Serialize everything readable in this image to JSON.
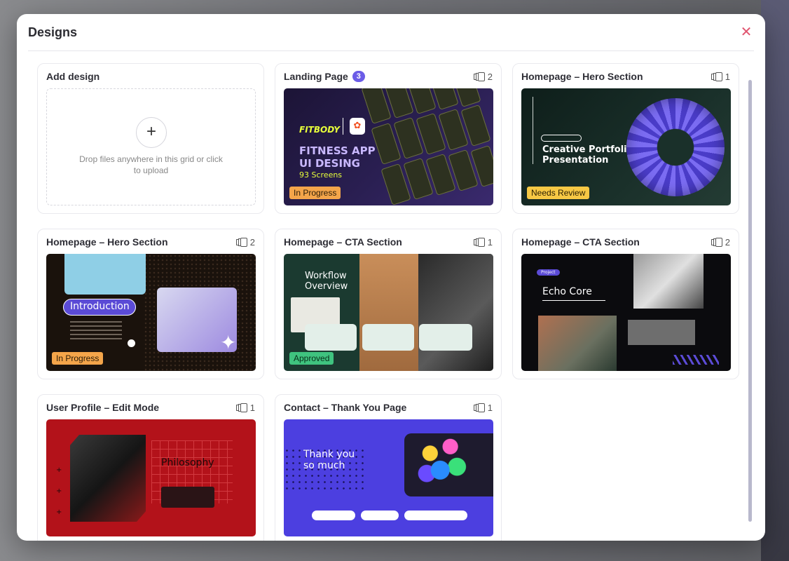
{
  "modal": {
    "title": "Designs",
    "close_icon": "close-icon"
  },
  "add_card": {
    "title": "Add design",
    "drop_text": "Drop files anywhere in this grid or click to upload"
  },
  "cards": [
    {
      "title": "Landing Page",
      "badge": "3",
      "pages": "2",
      "status": "In Progress",
      "thumb": {
        "brand": "FITBODY",
        "headline1": "FITNESS APP",
        "headline2": "UI DESING",
        "sub": "93 Screens"
      }
    },
    {
      "title": "Homepage – Hero Section",
      "pages": "1",
      "status": "Needs Review",
      "thumb": {
        "headline1": "Creative Portfolio",
        "headline2": "Presentation"
      }
    },
    {
      "title": "Homepage – Hero Section",
      "pages": "2",
      "status": "In Progress",
      "thumb": {
        "headline": "Introduction"
      }
    },
    {
      "title": "Homepage – CTA Section",
      "pages": "1",
      "status": "Approved",
      "thumb": {
        "headline1": "Workflow",
        "headline2": "Overview"
      }
    },
    {
      "title": "Homepage – CTA Section",
      "pages": "2",
      "status": "",
      "thumb": {
        "headline": "Echo Core",
        "tag": "Project"
      }
    },
    {
      "title": "User Profile – Edit Mode",
      "pages": "1",
      "status": "",
      "thumb": {
        "headline": "Philosophy"
      }
    },
    {
      "title": "Contact – Thank You Page",
      "pages": "1",
      "status": "",
      "thumb": {
        "headline1": "Thank you",
        "headline2": "so much"
      }
    }
  ],
  "colors": {
    "accent": "#6b5ce7",
    "in_progress": "#f4a54a",
    "needs_review": "#f7c844",
    "approved": "#3fc37f",
    "close": "#e05570"
  }
}
